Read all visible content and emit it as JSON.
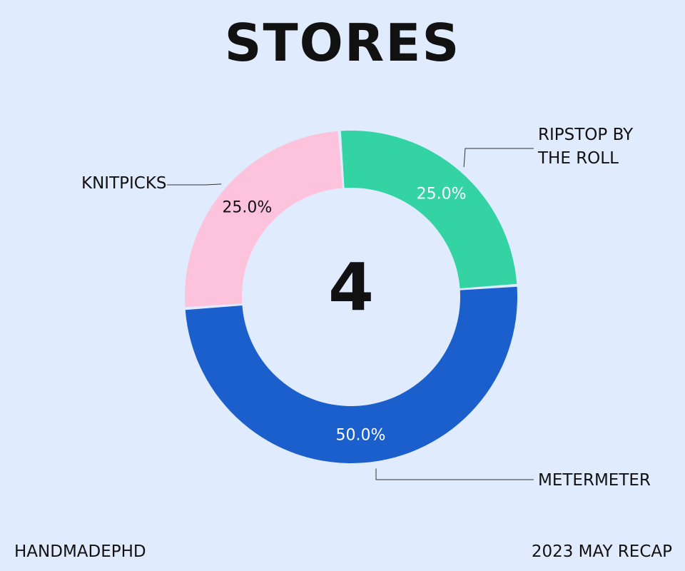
{
  "title": "STORES",
  "center_value": "4",
  "footer": {
    "left": "HANDMADEPHD",
    "right": "2023 MAY RECAP"
  },
  "chart_data": {
    "type": "pie",
    "title": "STORES",
    "hole_text": "4",
    "slices": [
      {
        "label": "RIPSTOP BY THE ROLL",
        "label_lines": [
          "RIPSTOP BY",
          "THE ROLL"
        ],
        "value": 1,
        "percent_label": "25.0%",
        "color": "#33d3a3",
        "text_color": "#ffffff"
      },
      {
        "label": "METERMETER",
        "label_lines": [
          "METERMETER"
        ],
        "value": 2,
        "percent_label": "50.0%",
        "color": "#1b5fcc",
        "text_color": "#ffffff"
      },
      {
        "label": "KNITPICKS",
        "label_lines": [
          "KNITPICKS"
        ],
        "value": 1,
        "percent_label": "25.0%",
        "color": "#fdc3dd",
        "text_color": "#111111"
      }
    ]
  }
}
